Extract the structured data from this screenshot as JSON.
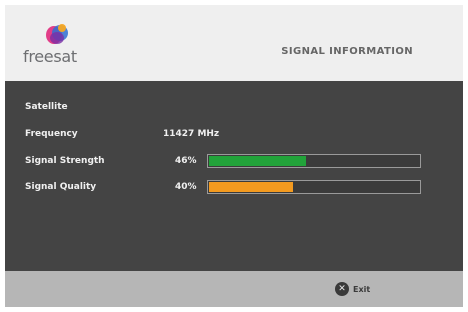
{
  "header": {
    "logo_text": "freesat",
    "title": "SIGNAL INFORMATION"
  },
  "section": {
    "heading": "Satellite"
  },
  "rows": {
    "frequency": {
      "label": "Frequency",
      "value": "11427 MHz"
    },
    "signal_strength": {
      "label": "Signal Strength",
      "percent_text": "46%",
      "level": 0.46,
      "color": "#22a33a"
    },
    "signal_quality": {
      "label": "Signal Quality",
      "percent_text": "40%",
      "level": 0.4,
      "color": "#f39a1f"
    }
  },
  "footer": {
    "exit_icon": "x-circle-icon",
    "exit_label": "Exit"
  },
  "colors": {
    "panel_bg": "#444444",
    "header_bg": "#efefef",
    "footer_bg": "#b6b6b6"
  }
}
